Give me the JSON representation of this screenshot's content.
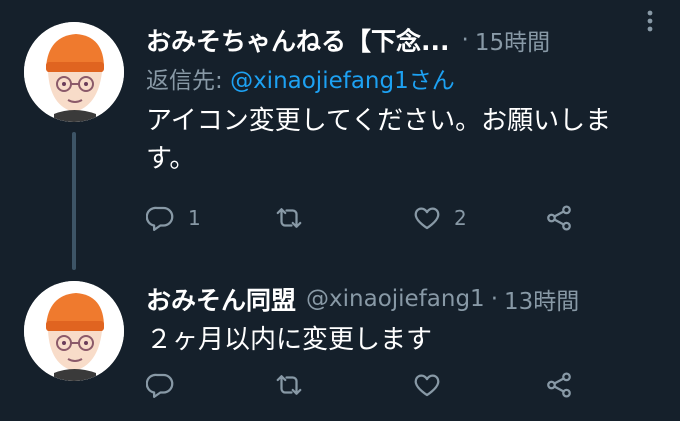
{
  "colors": {
    "background": "#15202b",
    "text_primary": "#ffffff",
    "text_secondary": "#8899a6",
    "link": "#1da1f2",
    "thread_line": "#3d5466"
  },
  "tweets": [
    {
      "name": "おみそちゃんねる【下念...",
      "handle": "",
      "dot": "·",
      "time": "15時間",
      "reply_prefix": "返信先: ",
      "reply_mention": "@xinaojiefang1さん",
      "text": "アイコン変更してください。お願いします。",
      "actions": {
        "reply_count": "1",
        "retweet_count": "",
        "like_count": "2"
      },
      "icons": [
        "avatar",
        "more-icon",
        "reply-icon",
        "retweet-icon",
        "like-icon",
        "share-icon"
      ]
    },
    {
      "name": "おみそん同盟",
      "handle": "@xinaojiefang1",
      "dot": "·",
      "time": "13時間",
      "text": "２ヶ月以内に変更します",
      "actions": {
        "reply_count": "",
        "retweet_count": "",
        "like_count": ""
      },
      "icons": [
        "avatar",
        "reply-icon",
        "retweet-icon",
        "like-icon",
        "share-icon"
      ]
    }
  ]
}
